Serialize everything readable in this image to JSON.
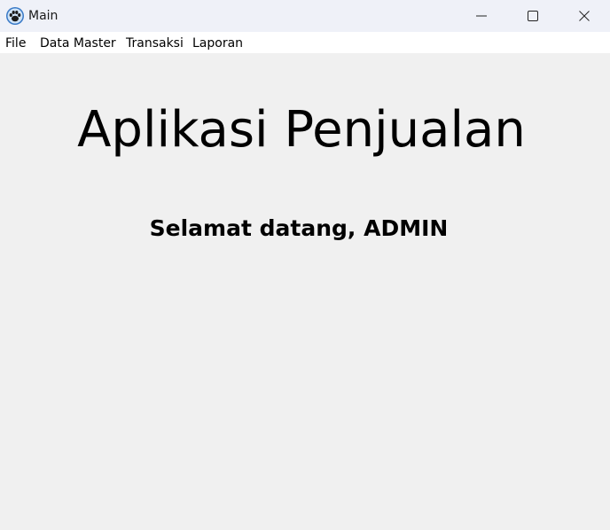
{
  "window": {
    "title": "Main",
    "icon": "paw-icon"
  },
  "menu": {
    "items": [
      "File",
      "Data Master",
      "Transaksi",
      "Laporan"
    ]
  },
  "main": {
    "heading": "Aplikasi Penjualan",
    "welcome": "Selamat datang, ADMIN"
  }
}
